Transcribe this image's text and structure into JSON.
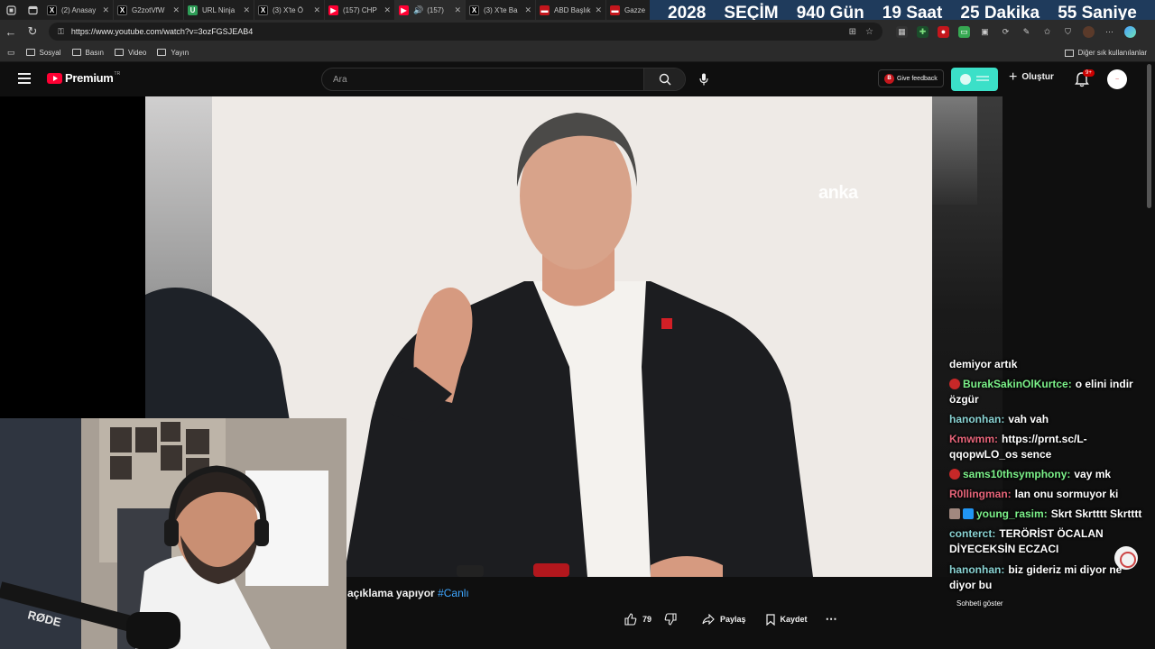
{
  "browser": {
    "tabs": [
      {
        "title": "(2) Anasay",
        "icon": "x-logo-icon"
      },
      {
        "title": "G2zotVfW",
        "icon": "x-logo-icon"
      },
      {
        "title": "URL Ninja",
        "icon": "url-ninja-icon"
      },
      {
        "title": "(3) X'te Ö",
        "icon": "x-logo-icon"
      },
      {
        "title": "(157) CHP",
        "icon": "youtube-icon"
      },
      {
        "title": "(157)",
        "icon": "youtube-icon"
      },
      {
        "title": "(3) X'te Ba",
        "icon": "x-logo-icon"
      },
      {
        "title": "ABD Başlık",
        "icon": "news-icon"
      },
      {
        "title": "Gazze",
        "icon": "news-icon"
      }
    ],
    "url": "https://www.youtube.com/watch?v=3ozFGSJEAB4",
    "bookmarks": [
      "Sosyal",
      "Basın",
      "Video",
      "Yayın"
    ],
    "bookmarks_other": "Diğer sık kullanılanlar"
  },
  "countdown": {
    "items": [
      "2028",
      "SEÇİM",
      "940 Gün",
      "19 Saat",
      "25 Dakika",
      "55 Saniye"
    ],
    "bg_color": "#1f3b5c"
  },
  "youtube": {
    "logo_text": "Premium",
    "logo_sup": "TR",
    "search_placeholder": "Ara",
    "feedback_label": "Give feedback",
    "create_label": "Oluştur",
    "notification_badge": "9+",
    "accent_color": "#ff0033"
  },
  "video": {
    "watermark": "anka",
    "title_text": "açıklama yapıyor",
    "title_hashtag": "#Canlı",
    "likes": "79",
    "share_label": "Paylaş",
    "save_label": "Kaydet"
  },
  "chat": {
    "messages": [
      {
        "user": "",
        "text": "demiyor artık"
      },
      {
        "user": "BurakSakinOlKurtce:",
        "text": "o elini indir özgür"
      },
      {
        "user": "hanonhan:",
        "text": "vah vah"
      },
      {
        "user": "Kmwmm:",
        "text": "https://prnt.sc/L-qqopwLO_os sence"
      },
      {
        "user": "sams10thsymphony:",
        "text": "vay mk"
      },
      {
        "user": "R0llingman:",
        "text": "lan onu sormuyor ki"
      },
      {
        "user": "young_rasim:",
        "text": "Skrt Skrtttt Skrtttt"
      },
      {
        "user": "conterct:",
        "text": "TERÖRİST ÖCALAN DİYECEKSİN ECZACI"
      },
      {
        "user": "hanonhan:",
        "text": "biz gideriz mi diyor ne diyor bu"
      }
    ],
    "show_chat_label": "Sohbeti göster"
  }
}
